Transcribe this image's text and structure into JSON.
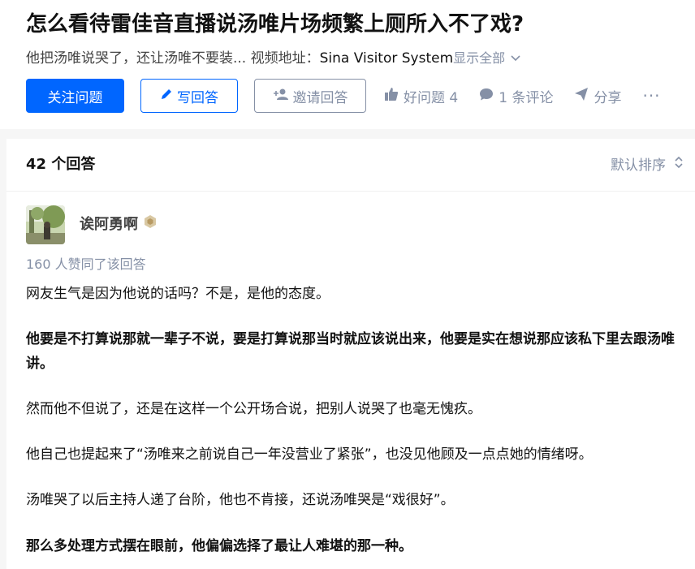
{
  "question": {
    "title": "怎么看待雷佳音直播说汤唯片场频繁上厕所入不了戏?",
    "desc_text": "他把汤唯说哭了，还让汤唯不要装... 视频地址：",
    "video_source": "Sina Visitor System",
    "show_all": "显示全部"
  },
  "actions": {
    "follow": "关注问题",
    "write_answer": "写回答",
    "invite": "邀请回答",
    "good_question": "好问题 4",
    "comments": "1 条评论",
    "share": "分享",
    "more": "···"
  },
  "answers": {
    "count_label": "42 个回答",
    "sort_label": "默认排序"
  },
  "answer": {
    "author": "诶阿勇啊",
    "upvotes": "160 人赞同了该回答",
    "paragraphs": [
      "网友生气是因为他说的话吗？不是，是他的态度。",
      "他要是不打算说那就一辈子不说，要是打算说那当时就应该说出来，他要是实在想说那应该私下里去跟汤唯讲。",
      "然而他不但说了，还是在这样一个公开场合说，把别人说哭了也毫无愧疚。",
      "他自己也提起来了“汤唯来之前说自己一年没营业了紧张”，也没见他顾及一点点她的情绪呀。",
      "汤唯哭了以后主持人递了台阶，他也不肯接，还说汤唯哭是“戏很好”。",
      "那么多处理方式摆在眼前，他偏偏选择了最让人难堪的那一种。"
    ]
  },
  "colors": {
    "primary": "#0066ff",
    "muted": "#8590a6",
    "text": "#121212",
    "background": "#f6f6f6"
  }
}
